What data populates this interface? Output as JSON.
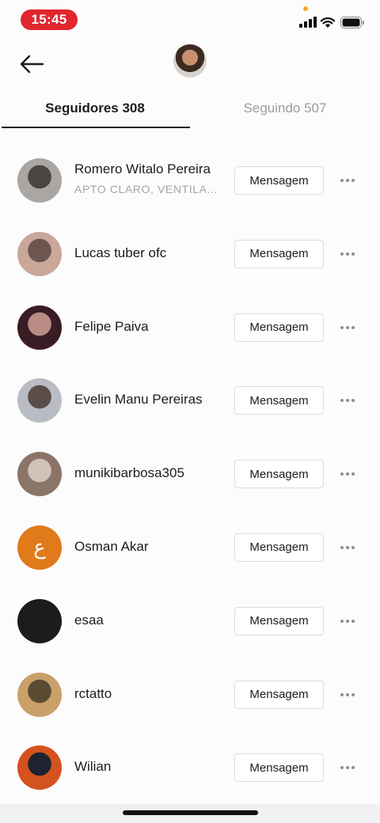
{
  "status_bar": {
    "time": "15:45"
  },
  "tabs": [
    {
      "label": "Seguidores 308",
      "active": true
    },
    {
      "label": "Seguindo 507",
      "active": false
    }
  ],
  "followers": [
    {
      "name": "Romero Witalo Pereira",
      "subtitle": "APTO CLARO, VENTILA...",
      "button": "Mensagem",
      "avatar_colors": [
        "#a9a6a4",
        "#4a4442"
      ]
    },
    {
      "name": "Lucas tuber ofc",
      "subtitle": "",
      "button": "Mensagem",
      "avatar_colors": [
        "#c9a79b",
        "#6d5650"
      ]
    },
    {
      "name": "Felipe Paiva",
      "subtitle": "",
      "button": "Mensagem",
      "avatar_colors": [
        "#3a1c24",
        "#b98d86"
      ]
    },
    {
      "name": "Evelin Manu Pereiras",
      "subtitle": "",
      "button": "Mensagem",
      "avatar_colors": [
        "#b9bcc4",
        "#5a4c48"
      ]
    },
    {
      "name": "munikibarbosa305",
      "subtitle": "",
      "button": "Mensagem",
      "avatar_colors": [
        "#8b7468",
        "#d0c2b8"
      ]
    },
    {
      "name": "Osman Akar",
      "subtitle": "",
      "button": "Mensagem",
      "avatar_colors": [
        "#e07a1a",
        "#e07a1a"
      ],
      "avatar_letter": "ع"
    },
    {
      "name": "esaa",
      "subtitle": "",
      "button": "Mensagem",
      "avatar_colors": [
        "#1c1c1e",
        "#1c1c1e"
      ]
    },
    {
      "name": "rctatto",
      "subtitle": "",
      "button": "Mensagem",
      "avatar_colors": [
        "#c9a06a",
        "#5b4a32"
      ]
    },
    {
      "name": "Wilian",
      "subtitle": "",
      "button": "Mensagem",
      "avatar_colors": [
        "#d4521e",
        "#1f2330"
      ]
    }
  ]
}
